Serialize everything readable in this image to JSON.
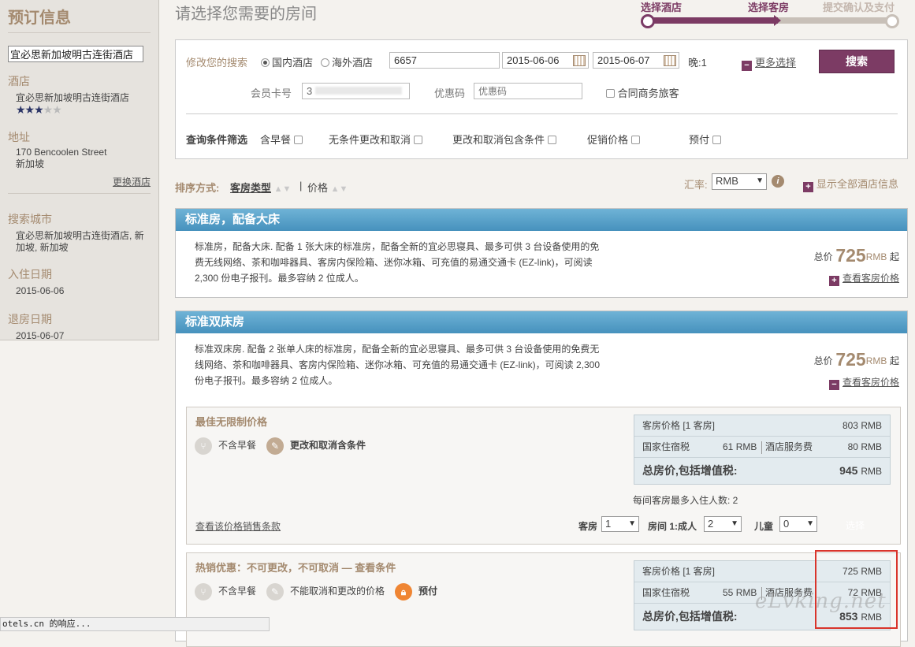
{
  "sidebar": {
    "title": "预订信息",
    "hotel_input": "宜必思新加坡明古连街酒店",
    "hotel_label": "酒店",
    "hotel_name": "宜必思新加坡明古连街酒店",
    "stars_rating": 3,
    "stars_max": 5,
    "address_label": "地址",
    "address_line1": "170 Bencoolen Street",
    "address_line2": "新加坡",
    "change_hotel": "更换酒店",
    "city_label": "搜索城市",
    "city_value": "宜必思新加坡明古连街酒店, 新加坡, 新加坡",
    "checkin_label": "入住日期",
    "checkin_value": "2015-06-06",
    "checkout_label": "退房日期",
    "checkout_value": "2015-06-07"
  },
  "header": {
    "title": "请选择您需要的房间",
    "steps": [
      "选择酒店",
      "选择客房",
      "提交确认及支付"
    ]
  },
  "search": {
    "modify_label": "修改您的搜索",
    "radio_domestic": "国内酒店",
    "radio_overseas": "海外酒店",
    "keyword": "6657",
    "checkin": "2015-06-06",
    "checkout": "2015-06-07",
    "nights_label": "晚:1",
    "more_options": "更多选择",
    "search_button": "搜索",
    "member_label": "会员卡号",
    "member_value": "3",
    "coupon_label": "优惠码",
    "coupon_placeholder": "优惠码",
    "corporate_label": "合同商务旅客",
    "filter_label": "查询条件筛选",
    "filters": [
      "含早餐",
      "无条件更改和取消",
      "更改和取消包含条件",
      "促销价格",
      "预付"
    ]
  },
  "sort": {
    "label": "排序方式:",
    "by_room": "客房类型",
    "separator": "|",
    "by_price": "价格",
    "rate_label": "汇率:",
    "currency": "RMB",
    "show_all": "显示全部酒店信息"
  },
  "rooms": [
    {
      "name": "标准房，配备大床",
      "desc": "标准房，配备大床. 配备 1 张大床的标准房，配备全新的宜必思寝具、最多可供 3 台设备使用的免费无线网络、茶和咖啡器具、客房内保险箱、迷你冰箱、可充值的易通交通卡 (EZ-link)，可阅读 2,300 份电子报刊。最多容纳 2 位成人。",
      "total_label": "总价",
      "price": "725",
      "unit": "RMB",
      "suffix": "起",
      "view_prices": "查看客房价格"
    },
    {
      "name": "标准双床房",
      "desc": "标准双床房. 配备 2 张单人床的标准房，配备全新的宜必思寝具、最多可供 3 台设备使用的免费无线网络、茶和咖啡器具、客房内保险箱、迷你冰箱、可充值的易通交通卡 (EZ-link)，可阅读 2,300 份电子报刊。最多容纳 2 位成人。",
      "total_label": "总价",
      "price": "725",
      "unit": "RMB",
      "suffix": "起",
      "view_prices": "查看客房价格"
    }
  ],
  "rates": [
    {
      "title": "最佳无限制价格",
      "feature1": "不含早餐",
      "feature2": "更改和取消含条件",
      "room_price_label": "客房价格 [1 客房]",
      "room_price": "803",
      "tax_label": "国家住宿税",
      "tax": "61",
      "service_label": "酒店服务费",
      "service": "80",
      "total_label": "总房价,包括增值税:",
      "total": "945",
      "unit": "RMB",
      "max_adults": "每间客房最多入住人数: 2",
      "sale_terms": "查看该价格销售条款",
      "rooms_label": "客房",
      "rooms_val": "1",
      "adults_label": "房间 1:成人",
      "adults_val": "2",
      "children_label": "儿童",
      "children_val": "0",
      "select": "选择"
    },
    {
      "title": "热销优惠：不可更改，不可取消 — 查看条件",
      "feature1": "不含早餐",
      "feature2": "不能取消和更改的价格",
      "feature3": "预付",
      "room_price_label": "客房价格 [1 客房]",
      "room_price": "725",
      "tax_label": "国家住宿税",
      "tax": "55",
      "service_label": "酒店服务费",
      "service": "72",
      "total_label": "总房价,包括增值税:",
      "total": "853",
      "unit": "RMB"
    }
  ],
  "status": "otels.cn 的响应...",
  "watermark": "eLvking.net",
  "colors": {
    "accent": "#7c3b64",
    "gold": "#a48a6f",
    "blue_header": "#4691bd",
    "highlight": "#d9342b"
  }
}
